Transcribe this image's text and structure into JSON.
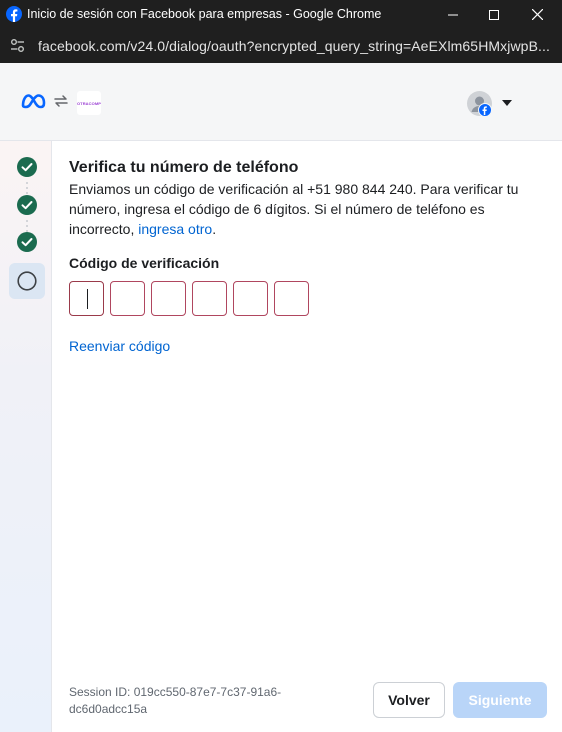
{
  "window": {
    "title": "Inicio de sesión con Facebook para empresas - Google Chrome",
    "url": "facebook.com/v24.0/dialog/oauth?encrypted_query_string=AeEXlm65HMxjwpB..."
  },
  "header": {
    "partner_logo_text": "OTRACOMP"
  },
  "steps": [
    {
      "status": "completed"
    },
    {
      "status": "completed"
    },
    {
      "status": "completed"
    },
    {
      "status": "current"
    }
  ],
  "content": {
    "title": "Verifica tu número de teléfono",
    "description": "Enviamos un código de verificación al +51 980 844 240. Para verificar tu número, ingresa el código de 6 dígitos. Si el número de teléfono es incorrecto, ",
    "change_link": "ingresa otro",
    "description_end": ".",
    "code_label": "Código de verificación",
    "code_digits": [
      "",
      "",
      "",
      "",
      "",
      ""
    ],
    "resend_link": "Reenviar código"
  },
  "footer": {
    "session_id": "Session ID: 019cc550-87e7-7c37-91a6-dc6d0adcc15a",
    "back_label": "Volver",
    "next_label": "Siguiente"
  },
  "colors": {
    "accent": "#0064d1",
    "step_complete": "#1b6b4f",
    "next_disabled": "#b9d5f8",
    "code_border": "#b0465f"
  }
}
